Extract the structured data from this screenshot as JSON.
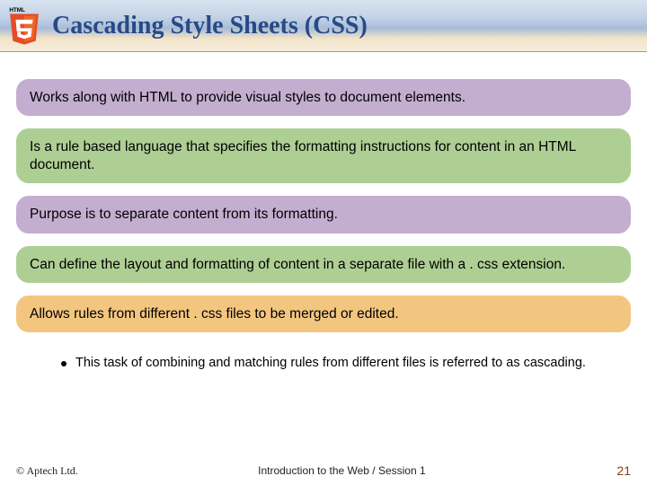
{
  "header": {
    "logo_label": "HTML5",
    "title": "Cascading Style Sheets (CSS)"
  },
  "cards": [
    "Works along with HTML to provide visual styles to document elements.",
    "Is a rule based language that specifies the formatting instructions for content in an HTML document.",
    "Purpose is to separate content from its formatting.",
    "Can define the layout and formatting of content in a separate file with a . css extension.",
    "Allows rules from different . css files to be merged or edited."
  ],
  "bullet": "This task of combining and matching rules from different files is referred to as cascading.",
  "footer": {
    "copyright": "© Aptech Ltd.",
    "session": "Introduction to the Web / Session 1",
    "page": "21"
  }
}
